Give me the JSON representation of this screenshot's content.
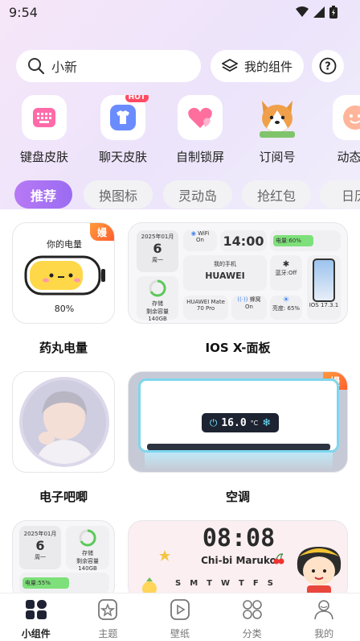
{
  "status": {
    "time": "9:54"
  },
  "search": {
    "placeholder": "小新"
  },
  "header": {
    "my_widgets": "我的组件"
  },
  "categories": [
    {
      "label": "键盘皮肤",
      "icon": "keyboard-icon"
    },
    {
      "label": "聊天皮肤",
      "icon": "shirt-icon",
      "badge": "HOT"
    },
    {
      "label": "自制锁屏",
      "icon": "heart-lock-icon"
    },
    {
      "label": "订阅号",
      "icon": "dog-icon"
    },
    {
      "label": "动态时",
      "icon": "face-icon"
    }
  ],
  "tags": [
    "推荐",
    "换图标",
    "灵动岛",
    "抢红包",
    "日历"
  ],
  "cards": {
    "battery": {
      "title": "药丸电量",
      "heading": "你的电量",
      "percent": "80%",
      "badge": "嫚"
    },
    "ios_panel": {
      "title": "IOS X-面板",
      "date": "2025年01月",
      "day": "6",
      "weekday": "周一",
      "wifi": "WiFi",
      "wifi_state": "On",
      "clock": "14:00",
      "battery_label": "电量:60%",
      "storage_label": "存储",
      "storage_remaining": "剩余容量",
      "storage_value": "140GB",
      "phone_label": "我的手机",
      "phone_brand": "HUAWEI",
      "bluetooth": "蓝牙:Off",
      "model": "HUAWEI Mate 70 Pro",
      "cellular": "蜂窝",
      "cellular_state": "On",
      "brightness": "亮度: 65%",
      "ios_version": "IOS 17.3.1"
    },
    "avatar": {
      "title": "电子吧唧"
    },
    "aircon": {
      "title": "空调",
      "temperature": "16.0",
      "unit": "°C",
      "badge": "嫚"
    },
    "mini_panel": {
      "date": "2025年01月",
      "day": "6",
      "weekday": "周一",
      "storage_label": "存储",
      "storage_remaining": "剩余容量",
      "storage_value": "140GB",
      "battery_label": "电量:55%"
    },
    "maruko": {
      "clock": "08:08",
      "caption": "Chi-bi Maruko",
      "days": [
        "S",
        "M",
        "T",
        "W",
        "T",
        "F",
        "S"
      ]
    }
  },
  "nav": [
    {
      "label": "小组件",
      "icon": "widget-icon",
      "active": true
    },
    {
      "label": "主题",
      "icon": "theme-icon"
    },
    {
      "label": "壁纸",
      "icon": "wallpaper-icon"
    },
    {
      "label": "分类",
      "icon": "category-icon"
    },
    {
      "label": "我的",
      "icon": "profile-icon"
    }
  ],
  "colors": {
    "accent": "#9a6cf2",
    "battery_yellow": "#ffd84a",
    "progress_green": "#7ee07a",
    "hot_badge": "#ff4b62",
    "vip_badge": "#ff6a2e"
  }
}
